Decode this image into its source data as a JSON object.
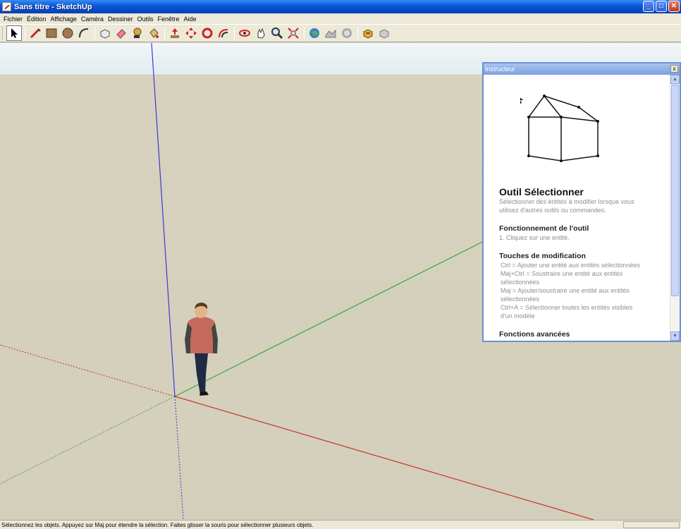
{
  "window": {
    "title": "Sans titre - SketchUp",
    "buttons": {
      "minimize": "_",
      "maximize": "□",
      "close": "✕"
    }
  },
  "menu": {
    "items": [
      "Fichier",
      "Édition",
      "Affichage",
      "Caméra",
      "Dessiner",
      "Outils",
      "Fenêtre",
      "Aide"
    ]
  },
  "toolbar": {
    "tools": [
      {
        "icon": "select-arrow-icon",
        "active": true
      },
      {
        "icon": "pencil-line-icon"
      },
      {
        "icon": "rectangle-icon"
      },
      {
        "icon": "circle-icon"
      },
      {
        "icon": "arc-icon"
      },
      {
        "icon": "make-component-icon"
      },
      {
        "icon": "eraser-icon"
      },
      {
        "icon": "tape-measure-icon"
      },
      {
        "icon": "paint-bucket-icon"
      },
      {
        "icon": "push-pull-icon"
      },
      {
        "icon": "move-icon"
      },
      {
        "icon": "rotate-icon"
      },
      {
        "icon": "offset-icon"
      },
      {
        "icon": "orbit-icon"
      },
      {
        "icon": "pan-icon"
      },
      {
        "icon": "zoom-icon"
      },
      {
        "icon": "zoom-extents-icon"
      },
      {
        "icon": "get-current-view-icon"
      },
      {
        "icon": "toggle-terrain-icon"
      },
      {
        "icon": "place-model-icon"
      },
      {
        "icon": "get-models-icon"
      },
      {
        "icon": "share-model-icon"
      }
    ]
  },
  "instructor": {
    "panel_title": "Instructeur",
    "close": "x",
    "tool_title": "Outil Sélectionner",
    "tool_desc": [
      "Sélectionner des entités à modifier lorsque vous",
      "utilisez d'autres outils ou commandes."
    ],
    "section1_title": "Fonctionnement de l'outil",
    "section1_items": [
      "1.    Cliquez sur une entité."
    ],
    "section2_title": "Touches de modification",
    "section2_lines": [
      "Ctrl = Ajouter une entité aux entités sélectionnées",
      "Maj+Ctrl = Soustraire une entité aux entités",
      "sélectionnées",
      "Maj = Ajouter/soustraire une entité aux entités",
      "sélectionnées",
      "Ctrl+A = Sélectionner toutes les entités visibles",
      "d'un modèle"
    ],
    "section3_title": "Fonctions avancées",
    "scroll_up": "▲",
    "scroll_down": "▼"
  },
  "status": {
    "text": "Sélectionnez les objets. Appuyez sur Maj pour étendre la sélection. Faites glisser la souris pour sélectionner plusieurs objets."
  },
  "colors": {
    "axis_red": "#c83228",
    "axis_green": "#3aa83a",
    "axis_blue": "#3a3ad0",
    "sky": "#e6eef3",
    "ground": "#d3cfbb"
  }
}
